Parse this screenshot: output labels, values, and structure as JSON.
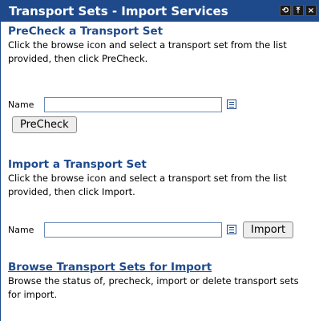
{
  "window": {
    "title": "Transport Sets - Import Services",
    "buttons": {
      "refresh": "⟲",
      "maximize": "⤒",
      "close": "×"
    }
  },
  "precheck": {
    "heading": "PreCheck a Transport Set",
    "description": "Click the browse icon and select a transport set from the list provided, then click PreCheck.",
    "name_label": "Name",
    "name_value": "",
    "button_label": "PreCheck"
  },
  "import": {
    "heading": "Import a Transport Set",
    "description": "Click the browse icon and select a transport set from the list provided, then click Import.",
    "name_label": "Name",
    "name_value": "",
    "button_label": "Import"
  },
  "browse": {
    "heading": "Browse Transport Sets for Import",
    "description": "Browse the status of, precheck, import or delete transport sets for import."
  },
  "colors": {
    "accent": "#1e4a8c"
  }
}
